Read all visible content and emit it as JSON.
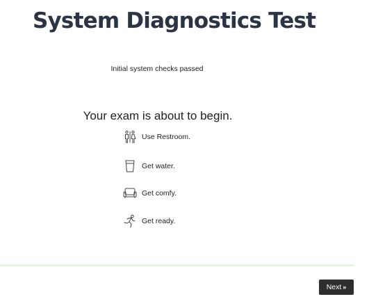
{
  "page": {
    "title": "System Diagnostics Test",
    "status": "Initial system checks passed",
    "heading": "Your exam is about to begin."
  },
  "checklist": [
    {
      "label": "Use Restroom.",
      "icon": "restroom-icon"
    },
    {
      "label": "Get water.",
      "icon": "water-glass-icon"
    },
    {
      "label": "Get comfy.",
      "icon": "couch-icon"
    },
    {
      "label": "Get ready.",
      "icon": "runner-icon"
    }
  ],
  "footer": {
    "next_label": "Next",
    "next_arrow": "»"
  },
  "colors": {
    "title": "#2b3445",
    "divider": "#e8f6e1",
    "button_bg": "#2e2e2e",
    "button_text": "#ffffff"
  }
}
